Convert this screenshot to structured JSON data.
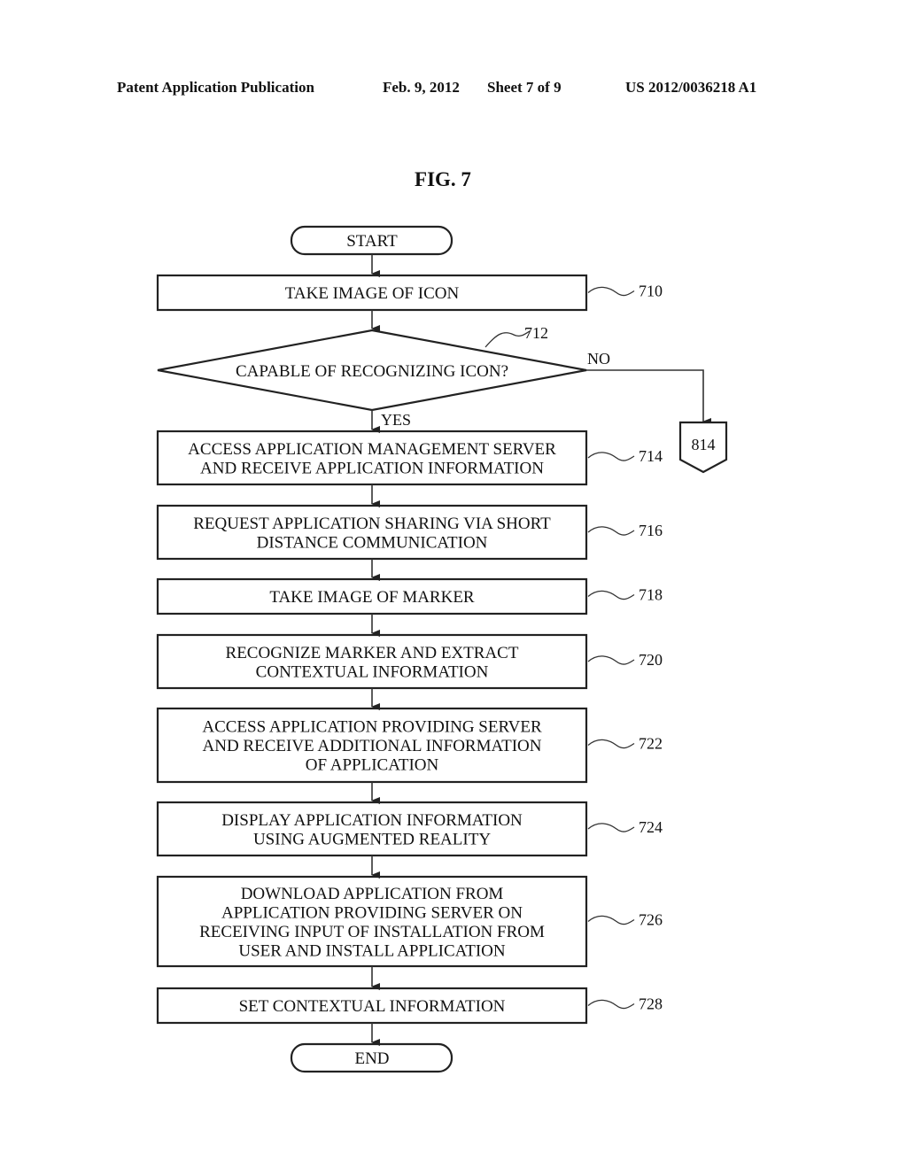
{
  "header": {
    "publication": "Patent Application Publication",
    "date": "Feb. 9, 2012",
    "sheet": "Sheet 7 of 9",
    "number": "US 2012/0036218 A1"
  },
  "figure": {
    "title": "FIG. 7",
    "start": "START",
    "end": "END",
    "steps": [
      {
        "ref": "710",
        "lines": [
          "TAKE IMAGE OF ICON"
        ]
      },
      {
        "ref": "714",
        "lines": [
          "ACCESS APPLICATION MANAGEMENT SERVER",
          "AND RECEIVE APPLICATION INFORMATION"
        ]
      },
      {
        "ref": "716",
        "lines": [
          "REQUEST APPLICATION SHARING VIA SHORT",
          "DISTANCE COMMUNICATION"
        ]
      },
      {
        "ref": "718",
        "lines": [
          "TAKE IMAGE OF MARKER"
        ]
      },
      {
        "ref": "720",
        "lines": [
          "RECOGNIZE MARKER AND EXTRACT",
          "CONTEXTUAL INFORMATION"
        ]
      },
      {
        "ref": "722",
        "lines": [
          "ACCESS APPLICATION PROVIDING SERVER",
          "AND RECEIVE ADDITIONAL INFORMATION",
          "OF APPLICATION"
        ]
      },
      {
        "ref": "724",
        "lines": [
          "DISPLAY APPLICATION INFORMATION",
          "USING AUGMENTED REALITY"
        ]
      },
      {
        "ref": "726",
        "lines": [
          "DOWNLOAD APPLICATION FROM",
          "APPLICATION PROVIDING SERVER ON",
          "RECEIVING INPUT OF INSTALLATION FROM",
          "USER AND INSTALL APPLICATION"
        ]
      },
      {
        "ref": "728",
        "lines": [
          "SET CONTEXTUAL INFORMATION"
        ]
      }
    ],
    "decision": {
      "ref": "712",
      "text": "CAPABLE OF RECOGNIZING ICON?",
      "yes": "YES",
      "no": "NO"
    },
    "connector": {
      "label": "814"
    }
  }
}
